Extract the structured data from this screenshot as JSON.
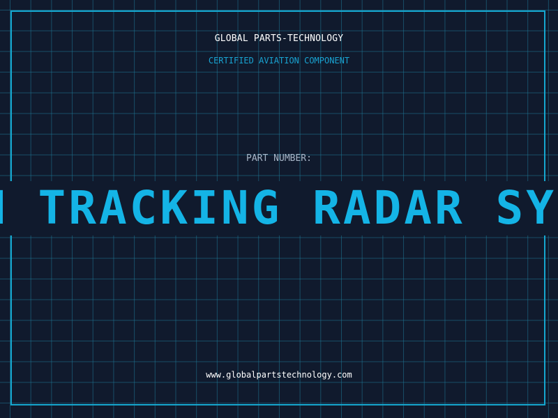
{
  "header": {
    "company": "GLOBAL PARTS-TECHNOLOGY",
    "tagline": "CERTIFIED AVIATION COMPONENT"
  },
  "part": {
    "label": "PART NUMBER:",
    "value": "M TRACKING RADAR SY"
  },
  "footer": {
    "url": "www.globalpartstechnology.com"
  },
  "colors": {
    "background": "#101a2d",
    "grid": "#1e7896",
    "frame": "#15a7cf",
    "accent": "#14b4e6"
  }
}
